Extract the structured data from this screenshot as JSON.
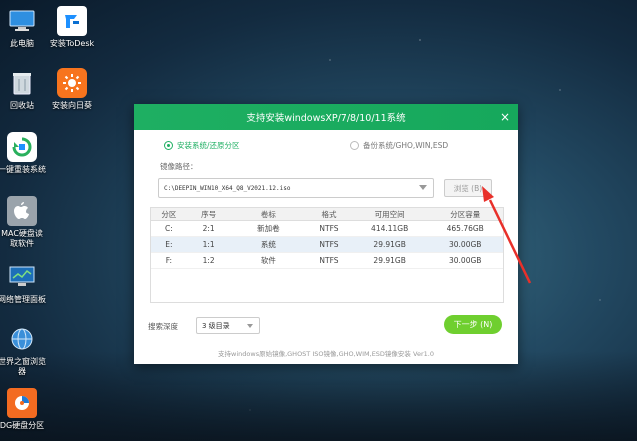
{
  "desktop": {
    "icons": [
      {
        "label": "此电脑"
      },
      {
        "label": "安装ToDesk"
      },
      {
        "label": "回收站"
      },
      {
        "label": "安装向日葵"
      },
      {
        "label": "一键重装系统"
      },
      {
        "label": "MAC硬盘读\n取软件"
      },
      {
        "label": "网络管理面板"
      },
      {
        "label": "世界之窗浏览\n器"
      },
      {
        "label": "DG硬盘分区"
      }
    ]
  },
  "dialog": {
    "title": "支持安装windowsXP/7/8/10/11系统",
    "close": "×",
    "option_install": "安装系统/还原分区",
    "option_backup": "备份系统/GHO,WIN,ESD",
    "image_path_label": "镜像路径：",
    "image_path_value": "C:\\DEEPIN_WIN10_X64_Q8_V2021.12.iso",
    "browse_button": "浏览 (B)",
    "table": {
      "headers": [
        "分区",
        "序号",
        "卷标",
        "格式",
        "可用空间",
        "分区容量"
      ],
      "rows": [
        [
          "C:",
          "2:1",
          "新加卷",
          "NTFS",
          "414.11GB",
          "465.76GB"
        ],
        [
          "E:",
          "1:1",
          "系统",
          "NTFS",
          "29.91GB",
          "30.00GB"
        ],
        [
          "F:",
          "1:2",
          "软件",
          "NTFS",
          "29.91GB",
          "30.00GB"
        ]
      ]
    },
    "search_depth_label": "搜索深度",
    "search_depth_value": "3 级目录",
    "next_button": "下一步 (N)",
    "footer": "支持windows原始镜像,GHOST ISO镜像,GHO,WIM,ESD镜像安装 Ver1.0"
  },
  "colors": {
    "title_bar": "#1eaf62",
    "next_button": "#6fcf2f",
    "annotation_arrow": "#e8302a"
  }
}
